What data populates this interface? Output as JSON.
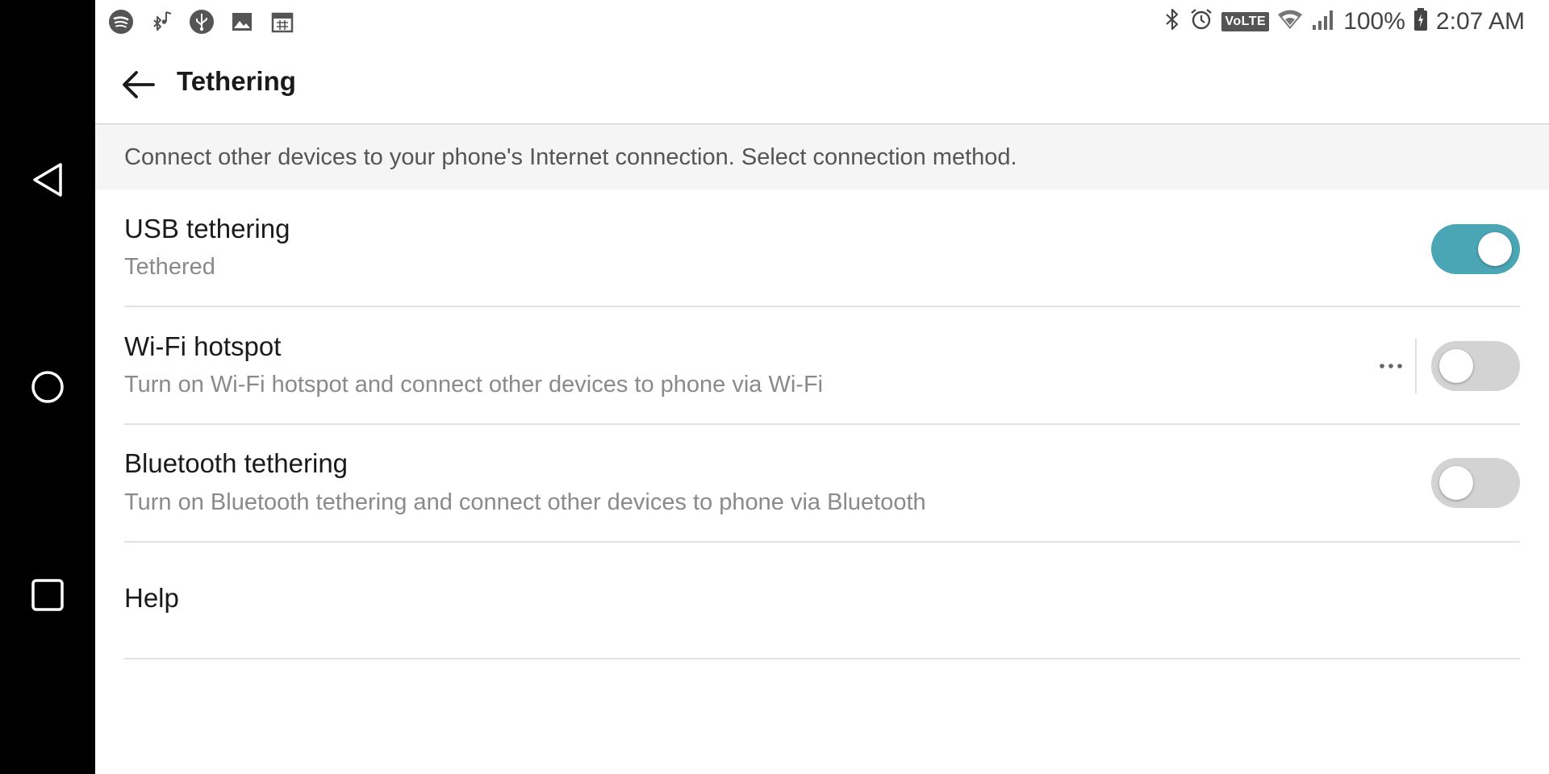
{
  "status_bar": {
    "left_icons": [
      "spotify-icon",
      "bluetooth-music-icon",
      "usb-icon",
      "image-icon",
      "calendar-icon"
    ],
    "right_icons": [
      "bluetooth-icon",
      "alarm-icon",
      "volte-badge",
      "wifi-icon",
      "signal-icon",
      "battery-icon"
    ],
    "volte_label": "VoLTE",
    "battery_percent": "100%",
    "time": "2:07 AM"
  },
  "nav_bar": {
    "buttons": [
      "back-triangle",
      "home-circle",
      "recents-square"
    ]
  },
  "app_bar": {
    "title": "Tethering"
  },
  "description": "Connect other devices to your phone's Internet connection. Select connection method.",
  "settings": [
    {
      "id": "usb-tethering",
      "title": "USB tethering",
      "subtitle": "Tethered",
      "enabled": true,
      "has_more": false
    },
    {
      "id": "wifi-hotspot",
      "title": "Wi-Fi hotspot",
      "subtitle": "Turn on Wi-Fi hotspot and connect other devices to phone via Wi-Fi",
      "enabled": false,
      "has_more": true
    },
    {
      "id": "bluetooth-tethering",
      "title": "Bluetooth tethering",
      "subtitle": "Turn on Bluetooth tethering and connect other devices to phone via Bluetooth",
      "enabled": false,
      "has_more": false
    }
  ],
  "help": {
    "label": "Help"
  },
  "colors": {
    "toggle_on": "#4aa6b5",
    "toggle_off": "#d3d3d3",
    "nav_bar": "#000000",
    "banner": "#f5f5f5"
  }
}
